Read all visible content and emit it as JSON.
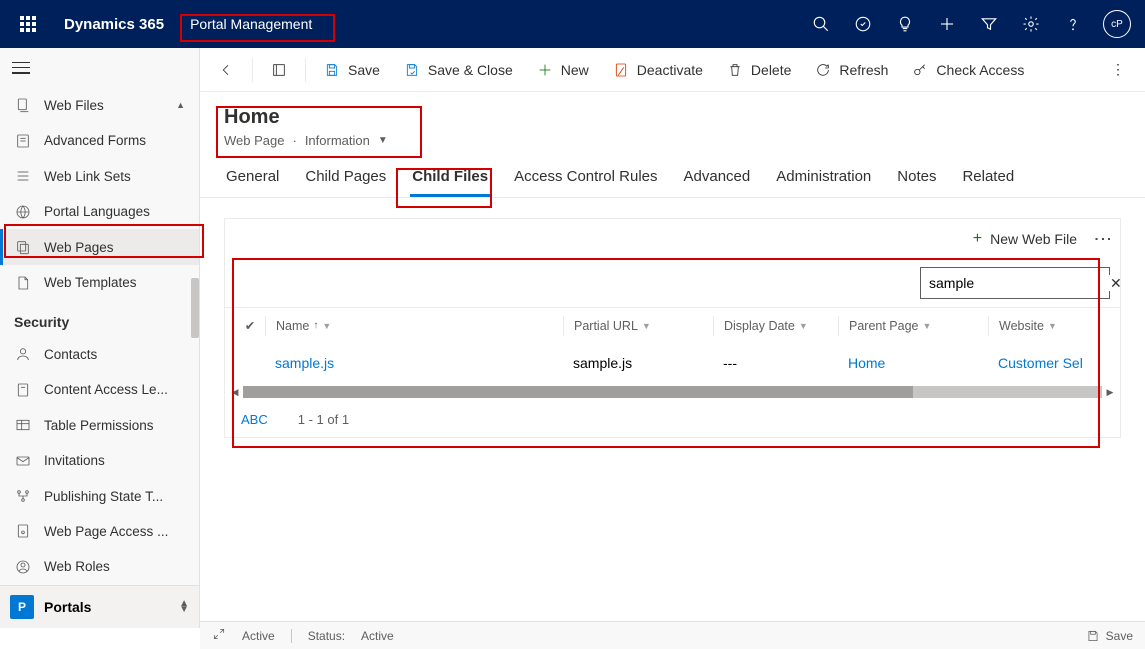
{
  "topbar": {
    "app_title": "Dynamics 365",
    "module_title": "Portal Management",
    "avatar_initials": "cP"
  },
  "sidebar": {
    "items": [
      {
        "label": "Web Files"
      },
      {
        "label": "Advanced Forms"
      },
      {
        "label": "Web Link Sets"
      },
      {
        "label": "Portal Languages"
      },
      {
        "label": "Web Pages"
      },
      {
        "label": "Web Templates"
      }
    ],
    "section_security": "Security",
    "security_items": [
      {
        "label": "Contacts"
      },
      {
        "label": "Content Access Le..."
      },
      {
        "label": "Table Permissions"
      },
      {
        "label": "Invitations"
      },
      {
        "label": "Publishing State T..."
      },
      {
        "label": "Web Page Access ..."
      },
      {
        "label": "Web Roles"
      }
    ],
    "bottom": {
      "badge": "P",
      "label": "Portals"
    }
  },
  "commands": {
    "save": "Save",
    "save_close": "Save & Close",
    "new": "New",
    "deactivate": "Deactivate",
    "delete": "Delete",
    "refresh": "Refresh",
    "check_access": "Check Access"
  },
  "header": {
    "title": "Home",
    "entity": "Web Page",
    "form": "Information"
  },
  "tabs": [
    "General",
    "Child Pages",
    "Child Files",
    "Access Control Rules",
    "Advanced",
    "Administration",
    "Notes",
    "Related"
  ],
  "panel": {
    "new_label": "New Web File",
    "search_value": "sample",
    "columns": {
      "name": "Name",
      "partial_url": "Partial URL",
      "display_date": "Display Date",
      "parent_page": "Parent Page",
      "website": "Website"
    },
    "row": {
      "name": "sample.js",
      "partial_url": "sample.js",
      "display_date": "---",
      "parent_page": "Home",
      "website": "Customer Sel"
    },
    "footer_abc": "ABC",
    "footer_count": "1 - 1 of 1"
  },
  "statusbar": {
    "active": "Active",
    "status_label": "Status:",
    "status_value": "Active",
    "save": "Save"
  }
}
